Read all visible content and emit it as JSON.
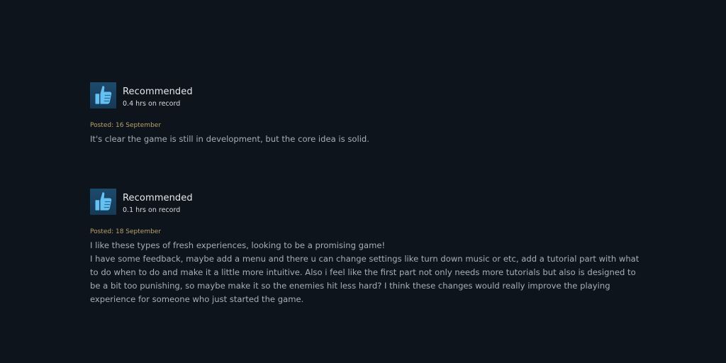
{
  "reviews": [
    {
      "verdict": "Recommended",
      "hours": "0.4 hrs on record",
      "posted": "Posted: 16 September",
      "paragraphs": [
        "It's clear the game is still in development, but the core idea is solid."
      ]
    },
    {
      "verdict": "Recommended",
      "hours": "0.1 hrs on record",
      "posted": "Posted: 18 September",
      "paragraphs": [
        "I like these types of fresh experiences, looking to be a promising game!",
        "I have some feedback, maybe add a menu and there u can change settings like turn down music or etc, add a tutorial part with what to do when to do and make it a little more intuitive. Also i feel like the first part not only needs more tutorials but also is designed to be a bit too punishing, so maybe make it so the enemies hit less hard? I think these changes would really improve the playing experience for someone who just started the game."
      ]
    }
  ],
  "icons": {
    "verdict_icon": "thumbs-up-icon"
  },
  "colors": {
    "background": "#0e141b",
    "posted": "#b8a26c",
    "body": "#a7aeb6",
    "thumb": "#66c0f4"
  }
}
